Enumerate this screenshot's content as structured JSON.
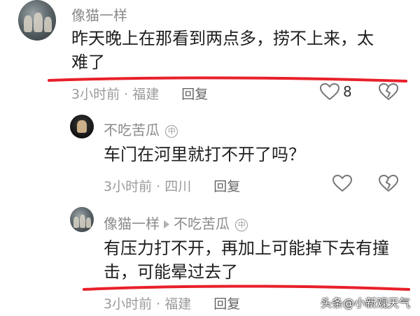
{
  "comments": [
    {
      "username": "像猫一样",
      "text_line1": "昨天晚上在那看到两点多，捞不上来，太",
      "text_line2": "难了",
      "time": "3小时前",
      "location": "福建",
      "reply_label": "回复",
      "like_count": "8"
    },
    {
      "username": "不吃苦瓜",
      "author_tag": "㊥",
      "text": "车门在河里就打不开了吗？",
      "time": "3小时前",
      "location": "四川",
      "reply_label": "回复"
    },
    {
      "username": "像猫一样",
      "reply_to": "不吃苦瓜",
      "author_tag": "㊥",
      "text_line1": "有压力打不开，再加上可能掉下去有撞",
      "text_line2": "击，可能晕过去了",
      "time": "3小时前",
      "location": "福建",
      "reply_label": "回复"
    }
  ],
  "watermark": "头条@小新观天气",
  "colors": {
    "highlight": "#e8202a",
    "meta": "#9a9a9a",
    "username": "#8a8a8a"
  }
}
